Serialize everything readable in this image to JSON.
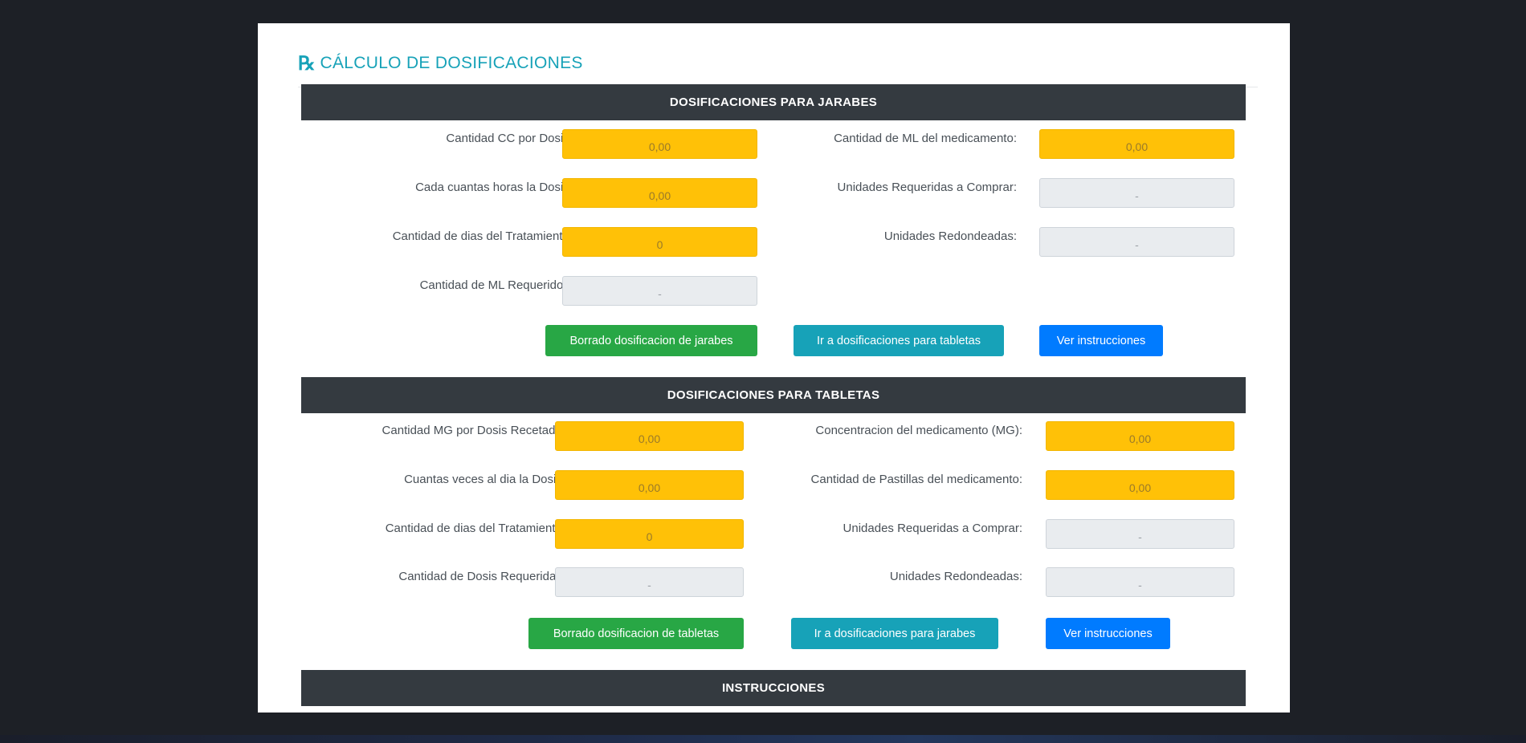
{
  "header": {
    "icon": "rx-icon",
    "title": "CÁLCULO DE DOSIFICACIONES"
  },
  "jarabes": {
    "title": "DOSIFICACIONES PARA JARABES",
    "left": [
      {
        "label": "Cantidad CC por Dosis:",
        "value": "0,00"
      },
      {
        "label": "Cada cuantas horas la Dosis:",
        "value": "0,00"
      },
      {
        "label": "Cantidad de dias del Tratamiento:",
        "value": "0"
      },
      {
        "label": "Cantidad de ML Requeridos:",
        "value": "-"
      }
    ],
    "right": [
      {
        "label": "Cantidad de ML del medicamento:",
        "value": "0,00"
      },
      {
        "label": "Unidades Requeridas a Comprar:",
        "value": "-"
      },
      {
        "label": "Unidades Redondeadas:",
        "value": "-"
      }
    ],
    "buttons": {
      "clear": "Borrado dosificacion de jarabes",
      "goto": "Ir a dosificaciones para tabletas",
      "instructions": "Ver instrucciones"
    }
  },
  "tabletas": {
    "title": "DOSIFICACIONES PARA TABLETAS",
    "left": [
      {
        "label": "Cantidad MG por Dosis Recetada:",
        "value": "0,00"
      },
      {
        "label": "Cuantas veces al dia la Dosis:",
        "value": "0,00"
      },
      {
        "label": "Cantidad de dias del Tratamiento:",
        "value": "0"
      },
      {
        "label": "Cantidad de Dosis Requeridas:",
        "value": "-"
      }
    ],
    "right": [
      {
        "label": "Concentracion del medicamento (MG):",
        "value": "0,00"
      },
      {
        "label": "Cantidad de Pastillas del medicamento:",
        "value": "0,00"
      },
      {
        "label": "Unidades Requeridas a Comprar:",
        "value": "-"
      },
      {
        "label": "Unidades Redondeadas:",
        "value": "-"
      }
    ],
    "buttons": {
      "clear": "Borrado dosificacion de tabletas",
      "goto": "Ir a dosificaciones para jarabes",
      "instructions": "Ver instrucciones"
    }
  },
  "instrucciones": {
    "title": "INSTRUCCIONES"
  },
  "colors": {
    "input_editable": "#ffc107",
    "input_readonly": "#e9ecef",
    "section_header": "#343a40",
    "accent": "#17a2b8",
    "btn_success": "#28a745",
    "btn_info": "#17a2b8",
    "btn_primary": "#007bff"
  }
}
